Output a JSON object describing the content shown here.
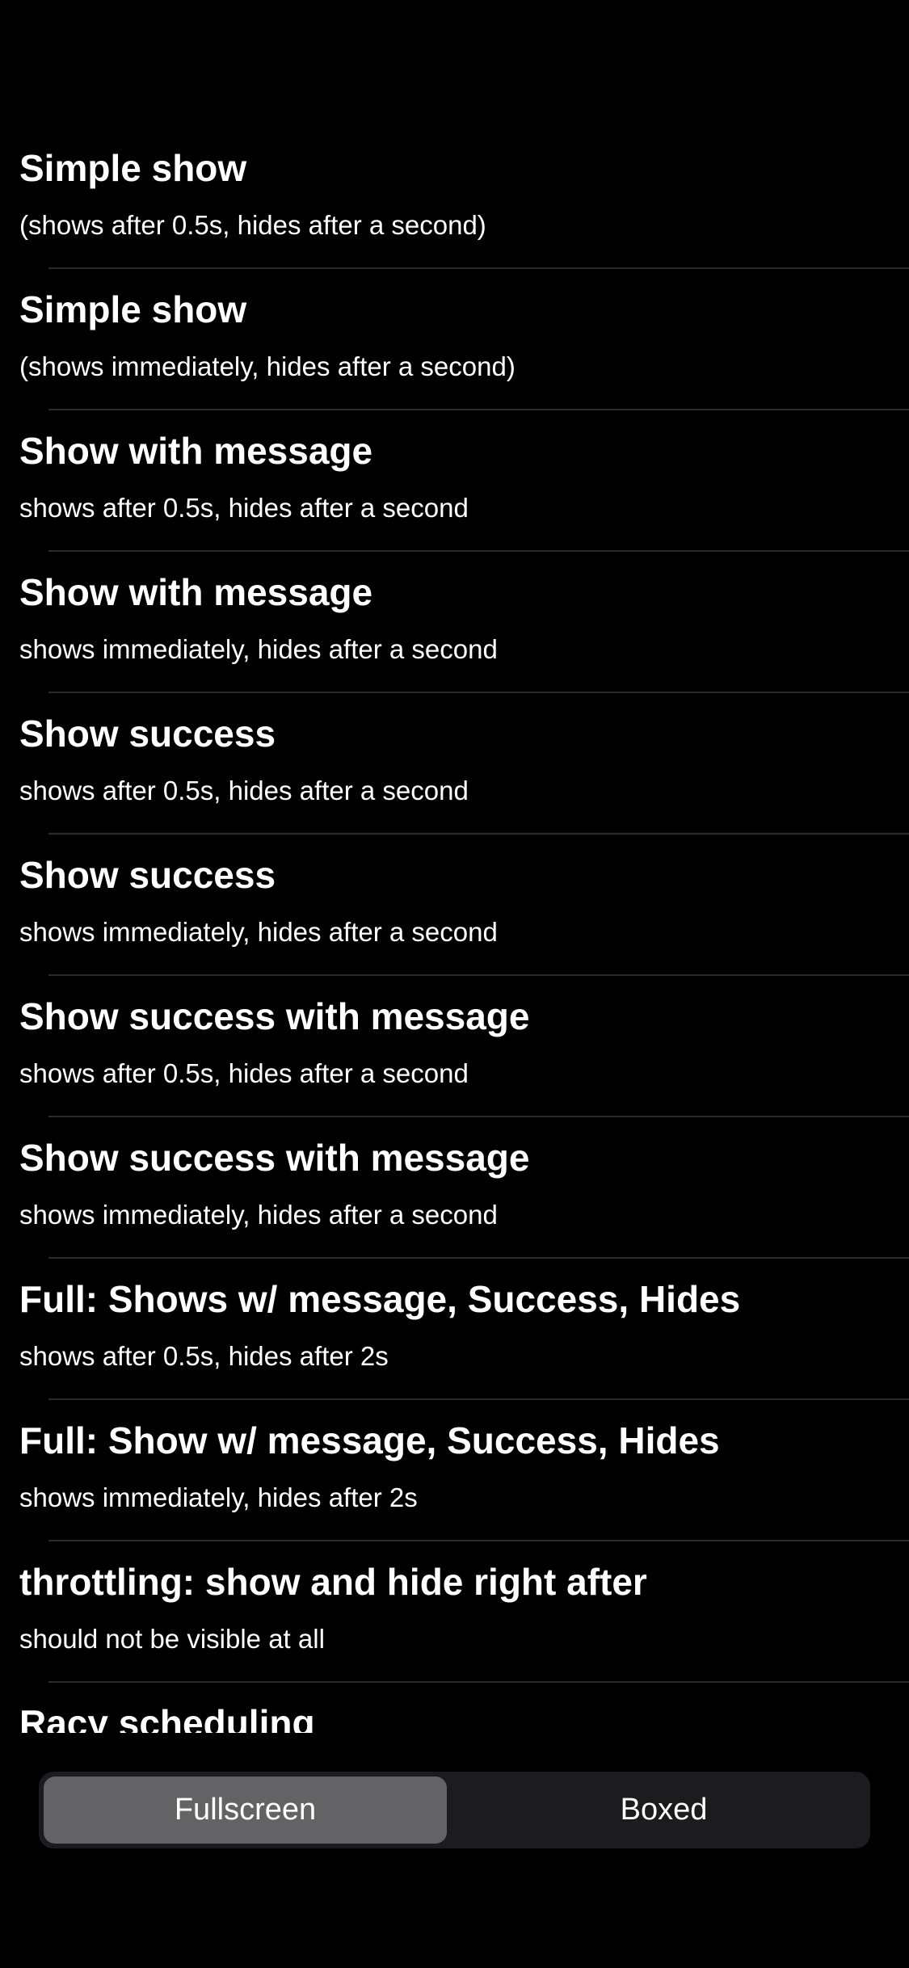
{
  "rows": [
    {
      "title": "Simple show",
      "subtitle": "(shows after 0.5s, hides after a second)"
    },
    {
      "title": "Simple show",
      "subtitle": "(shows immediately, hides after a second)"
    },
    {
      "title": "Show with message",
      "subtitle": "shows after 0.5s, hides after a second"
    },
    {
      "title": "Show with message",
      "subtitle": "shows immediately, hides after a second"
    },
    {
      "title": "Show success",
      "subtitle": "shows after 0.5s, hides after a second"
    },
    {
      "title": "Show success",
      "subtitle": "shows immediately, hides after a second"
    },
    {
      "title": "Show success with message",
      "subtitle": "shows after 0.5s, hides after a second"
    },
    {
      "title": "Show success with message",
      "subtitle": "shows immediately, hides after a second"
    },
    {
      "title": "Full: Shows w/ message, Success, Hides",
      "subtitle": "shows after 0.5s, hides after 2s"
    },
    {
      "title": "Full: Show w/ message, Success, Hides",
      "subtitle": "shows immediately, hides after 2s"
    },
    {
      "title": "throttling: show and hide right after",
      "subtitle": "should not be visible at all"
    },
    {
      "title": "Racy scheduling",
      "subtitle": ""
    }
  ],
  "segmented_control": {
    "options": [
      "Fullscreen",
      "Boxed"
    ],
    "selected": "Fullscreen"
  },
  "colors": {
    "background": "#000000",
    "text": "#ffffff",
    "separator": "#2b2b2d",
    "segment_track": "#1c1c1e",
    "segment_selected": "#636366"
  }
}
